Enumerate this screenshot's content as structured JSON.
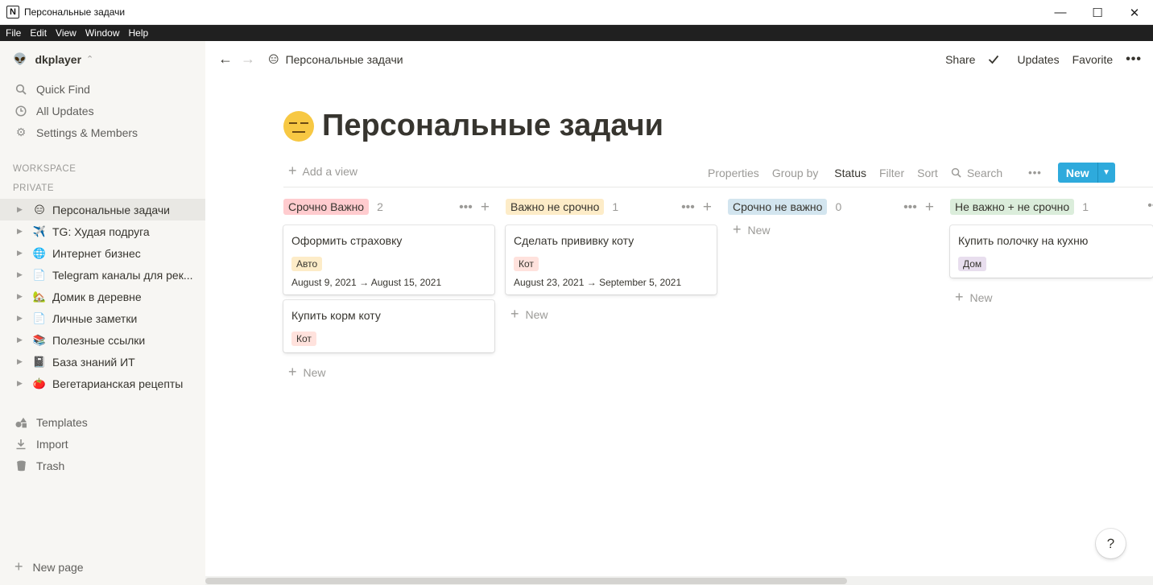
{
  "window": {
    "title": "Персональные задачи",
    "app_icon": "N",
    "controls": [
      "—",
      "☐",
      "✕"
    ]
  },
  "menu": [
    "File",
    "Edit",
    "View",
    "Window",
    "Help"
  ],
  "sidebar": {
    "workspace": "dkplayer",
    "actions": [
      {
        "label": "Quick Find",
        "icon": "search-icon"
      },
      {
        "label": "All Updates",
        "icon": "clock-icon"
      },
      {
        "label": "Settings & Members",
        "icon": "gear-icon"
      }
    ],
    "section_workspace": "WORKSPACE",
    "section_private": "PRIVATE",
    "pages": [
      {
        "label": "Персональные задачи",
        "emoji": "😑",
        "selected": true
      },
      {
        "label": "TG: Худая подруга",
        "emoji": "✈️"
      },
      {
        "label": "Интернет бизнес",
        "emoji": "🌐"
      },
      {
        "label": "Telegram каналы для рек...",
        "emoji": "📄"
      },
      {
        "label": "Домик в деревне",
        "emoji": "🏡"
      },
      {
        "label": "Личные заметки",
        "emoji": "📄"
      },
      {
        "label": "Полезные ссылки",
        "emoji": "📚"
      },
      {
        "label": "База знаний ИТ",
        "emoji": "📓"
      },
      {
        "label": "Вегетарианская рецепты",
        "emoji": "🍅"
      }
    ],
    "footer": [
      {
        "label": "Templates",
        "icon": "shapes-icon"
      },
      {
        "label": "Import",
        "icon": "download-icon"
      },
      {
        "label": "Trash",
        "icon": "trash-icon"
      }
    ],
    "new_page": "New page"
  },
  "topbar": {
    "breadcrumb": "Персональные задачи",
    "share": "Share",
    "updates": "Updates",
    "favorite": "Favorite",
    "more": "•••"
  },
  "page": {
    "title": "Персональные задачи",
    "emoji": "😑"
  },
  "toolbar": {
    "add_view": "Add a view",
    "properties": "Properties",
    "group_by": "Group by",
    "group_by_value": "Status",
    "filter": "Filter",
    "sort": "Sort",
    "search": "Search",
    "more": "•••",
    "new": "New"
  },
  "board": {
    "new_label": "New",
    "columns": [
      {
        "name": "Срочно Важно",
        "count": "2",
        "color": "#ffcccf",
        "cards": [
          {
            "title": "Оформить страховку",
            "tag": "Авто",
            "tag_color": "#fdecc8",
            "date": "August 9, 2021 → August 15, 2021"
          },
          {
            "title": "Купить корм коту",
            "tag": "Кот",
            "tag_color": "#ffe2dd",
            "date": ""
          }
        ]
      },
      {
        "name": "Важно не срочно",
        "count": "1",
        "color": "#fdecc8",
        "cards": [
          {
            "title": "Сделать прививку коту",
            "tag": "Кот",
            "tag_color": "#ffe2dd",
            "date": "August 23, 2021 → September 5, 2021"
          }
        ]
      },
      {
        "name": "Срочно не важно",
        "count": "0",
        "color": "#d3e5ef",
        "cards": []
      },
      {
        "name": "Не важно + не срочно",
        "count": "1",
        "color": "#dbeddb",
        "cards": [
          {
            "title": "Купить полочку на кухню",
            "tag": "Дом",
            "tag_color": "#e8deee",
            "date": ""
          }
        ]
      }
    ]
  },
  "help": "?"
}
